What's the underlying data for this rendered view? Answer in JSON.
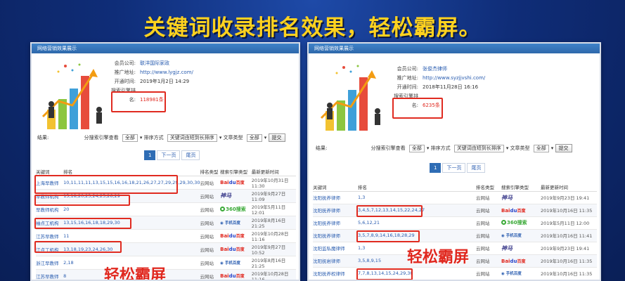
{
  "headline": "关键词收录排名效果，轻松霸屏。",
  "left": {
    "panel_title": "网络营销效果展示",
    "info": [
      {
        "k": "会员公司:",
        "v": "联洋国际家政"
      },
      {
        "k": "推广地址:",
        "v": "http://www.lygjz.com/"
      },
      {
        "k": "开通时间:",
        "v": "2019年1月2日 14:29"
      }
    ],
    "rank_label": "搜索引擎排",
    "rank_label2": "名:",
    "rank_value": "118981条",
    "filters": {
      "result_label": "结果:",
      "engine_label": "分搜索引擎查看",
      "engine_value": "全部",
      "sort_label": "排序方式",
      "sort_value": "关键词由短到长排序",
      "type_label": "文章类型",
      "type_value": "全部",
      "submit": "提交"
    },
    "pager": {
      "current": "1",
      "next": "下一页",
      "last": "尾页"
    },
    "headers": [
      "关键词",
      "排名",
      "排名类型",
      "搜索引擎类型",
      "最新更新时间"
    ],
    "rows": [
      {
        "kw": "上海早教师",
        "rank": "10,11,11,11,13,15,15,16,16,18,21,26,27,27,29,29,29,30,30",
        "type": "云网站",
        "engine": "baidu",
        "time": "2019年10月31日 11:30"
      },
      {
        "kw": "早教师机构",
        "rank": "15,18,20,23,24,25,26,29",
        "type": "云网站",
        "engine": "shenma",
        "time": "2019年9月27日 11:09"
      },
      {
        "kw": "早教师机构",
        "rank": "20",
        "type": "云网站",
        "engine": "s360",
        "time": "2019年5月11日 12:01"
      },
      {
        "kw": "袖点工机构",
        "rank": "13,15,16,16,18,18,29,30",
        "type": "云网站",
        "engine": "mbaidu",
        "time": "2019年8月16日 21:25"
      },
      {
        "kw": "江苏早教师",
        "rank": "11",
        "type": "云网站",
        "engine": "baidu",
        "time": "2019年10月28日 11:16"
      },
      {
        "kw": "江点工机构",
        "rank": "13,18,19,23,24,26,30",
        "type": "云网站",
        "engine": "baidu",
        "time": "2019年9月27日 10:52"
      },
      {
        "kw": "浙江早教师",
        "rank": "2,18",
        "type": "云网站",
        "engine": "mbaidu",
        "time": "2019年8月16日 21:25"
      },
      {
        "kw": "江苏早教师",
        "rank": "8",
        "type": "云网站",
        "engine": "baidu",
        "time": "2019年10月28日 11:16"
      }
    ],
    "callout": "轻松霸屏"
  },
  "right": {
    "panel_title": "网络营销效果展示",
    "info": [
      {
        "k": "会员公司:",
        "v": "张俊杰律师"
      },
      {
        "k": "推广地址:",
        "v": "http://www.syzjjvshi.com/"
      },
      {
        "k": "开通时间:",
        "v": "2018年11月28日 16:16"
      }
    ],
    "rank_label": "搜索引擎排",
    "rank_label2": "名:",
    "rank_value": "6235条",
    "filters": {
      "result_label": "结果:",
      "engine_label": "分搜索引擎查看",
      "engine_value": "全部",
      "sort_label": "排序方式",
      "sort_value": "关键词由短到长排序",
      "type_label": "文章类型",
      "type_value": "全部",
      "submit": "提交"
    },
    "pager": {
      "current": "1",
      "next": "下一页",
      "last": "尾页"
    },
    "headers": [
      "关键词",
      "排名",
      "排名类型",
      "搜索引擎类型",
      "最新更新时间"
    ],
    "rows": [
      {
        "kw": "沈阳抚养律师",
        "rank": "1,3",
        "type": "云网站",
        "engine": "shenma",
        "time": "2019年9月23日 19:41"
      },
      {
        "kw": "沈阳抚养律师",
        "rank": "3,4,5,7,12,13,14,15,22,24,27",
        "type": "云网站",
        "engine": "baidu",
        "time": "2019年10月16日 11:35"
      },
      {
        "kw": "沈阳抚养律师",
        "rank": "5,6,12,21",
        "type": "云网站",
        "engine": "s360",
        "time": "2019年5月11日 12:00"
      },
      {
        "kw": "沈阳抚养律师",
        "rank": "3,5,7,8,9,14,16,18,28,29",
        "type": "云网站",
        "engine": "mbaidu",
        "time": "2019年10月16日 11:41"
      },
      {
        "kw": "沈阳监私魔律师",
        "rank": "1,3",
        "type": "云网站",
        "engine": "shenma",
        "time": "2019年9月23日 19:41"
      },
      {
        "kw": "沈阳抚岩律师",
        "rank": "3,5,8,9,15",
        "type": "云网站",
        "engine": "baidu",
        "time": "2019年10月16日 11:35"
      },
      {
        "kw": "沈阳抚养权律师",
        "rank": "7,7,8,13,14,15,24,29,30",
        "type": "云网站",
        "engine": "mbaidu",
        "time": "2019年10月16日 11:35"
      },
      {
        "kw": "沈阳抚养律师",
        "rank": "1",
        "type": "云网站",
        "engine": "shenma",
        "time": "2019年9月23日 19:41"
      }
    ],
    "callout": "轻松霸屏"
  },
  "engine_labels": {
    "baidu_a": "Bai",
    "baidu_b": "du",
    "baidu_c": "百度",
    "s360": "360搜索",
    "mbaidu": "手机百度",
    "shenma": "神马"
  },
  "colors": {
    "accent_red": "#e0281f",
    "link_blue": "#2a5db0",
    "headline_yellow": "#ffd21f",
    "panel_header": "#2e68ab"
  }
}
